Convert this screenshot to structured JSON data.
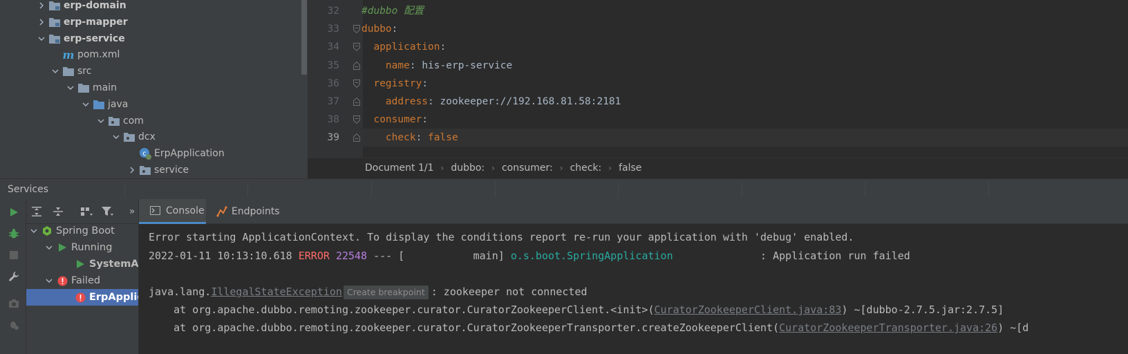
{
  "project_tree": {
    "items": [
      {
        "label": "erp-domain",
        "bold": true,
        "indent": 0,
        "chevron": ">",
        "icon": "module-folder-icon"
      },
      {
        "label": "erp-mapper",
        "bold": true,
        "indent": 0,
        "chevron": ">",
        "icon": "module-folder-icon"
      },
      {
        "label": "erp-service",
        "bold": true,
        "indent": 0,
        "chevron": "v",
        "icon": "module-folder-icon"
      },
      {
        "label": "pom.xml",
        "bold": false,
        "indent": 1,
        "chevron": "",
        "icon": "maven-icon"
      },
      {
        "label": "src",
        "bold": false,
        "indent": 1,
        "chevron": "v",
        "icon": "folder-icon"
      },
      {
        "label": "main",
        "bold": false,
        "indent": 2,
        "chevron": "v",
        "icon": "folder-icon"
      },
      {
        "label": "java",
        "bold": false,
        "indent": 3,
        "chevron": "v",
        "icon": "source-folder-icon"
      },
      {
        "label": "com",
        "bold": false,
        "indent": 4,
        "chevron": "v",
        "icon": "package-icon"
      },
      {
        "label": "dcx",
        "bold": false,
        "indent": 5,
        "chevron": "v",
        "icon": "package-icon"
      },
      {
        "label": "ErpApplication",
        "bold": false,
        "indent": 6,
        "chevron": "",
        "icon": "spring-class-icon"
      },
      {
        "label": "service",
        "bold": false,
        "indent": 6,
        "chevron": ">",
        "icon": "package-icon"
      }
    ]
  },
  "editor": {
    "lines": [
      {
        "num": "32",
        "comment": "#dubbo 配置"
      },
      {
        "num": "33",
        "key": "dubbo",
        "value": ""
      },
      {
        "num": "34",
        "key": "application",
        "value": ""
      },
      {
        "num": "35",
        "key": "name",
        "value": "his-erp-service"
      },
      {
        "num": "36",
        "key": "registry",
        "value": ""
      },
      {
        "num": "37",
        "key": "address",
        "value": "zookeeper://192.168.81.58:2181"
      },
      {
        "num": "38",
        "key": "consumer",
        "value": ""
      },
      {
        "num": "39",
        "key": "check",
        "value": "false"
      }
    ],
    "breadcrumb": [
      "Document 1/1",
      "dubbo:",
      "consumer:",
      "check:",
      "false"
    ]
  },
  "services": {
    "title": "Services",
    "tree": [
      {
        "label": "Spring Boot",
        "chevron": "v",
        "icon": "spring-boot-icon",
        "indent": 0
      },
      {
        "label": "Running",
        "chevron": "v",
        "icon": "run-icon",
        "indent": 1
      },
      {
        "label": "SystemAp",
        "chevron": "",
        "icon": "run-icon",
        "indent": 2,
        "bold": true
      },
      {
        "label": "Failed",
        "chevron": "v",
        "icon": "error-icon",
        "indent": 1
      },
      {
        "label": "ErpApplica",
        "chevron": "",
        "icon": "error-icon",
        "indent": 2,
        "bold": true,
        "selected": true
      }
    ],
    "tabs": [
      {
        "label": "Console",
        "icon": "console-icon",
        "active": true
      },
      {
        "label": "Endpoints",
        "icon": "endpoints-icon",
        "active": false
      }
    ]
  },
  "console": {
    "line1": "Error starting ApplicationContext. To display the conditions report re-run your application with 'debug' enabled.",
    "line2": {
      "timestamp": "2022-01-11 10:13:10.618",
      "level": "ERROR",
      "pid": "22548",
      "sep": "--- [",
      "thread": "           main]",
      "logger": "o.s.boot.SpringApplication",
      "message": "              : Application run failed"
    },
    "line4": {
      "prefix": "java.lang.",
      "exception": "IllegalStateException",
      "hint": "Create breakpoint",
      "message": ": zookeeper not connected"
    },
    "line5": {
      "prefix": "    at org.apache.dubbo.remoting.zookeeper.curator.CuratorZookeeperClient.<init>(",
      "link": "CuratorZookeeperClient.java:83",
      "suffix": ") ~[dubbo-2.7.5.jar:2.7.5]"
    },
    "line6": {
      "prefix": "    at org.apache.dubbo.remoting.zookeeper.curator.CuratorZookeeperTransporter.createZookeeperClient(",
      "link": "CuratorZookeeperTransporter.java:26",
      "suffix": ") ~[d"
    }
  },
  "colors": {
    "key": "#cc7832",
    "value": "#a9b7c6",
    "comment": "#629755",
    "error": "#ff6b68",
    "logger": "#2aaaa0",
    "pid": "#b87fe0",
    "selection": "#4b6eaf"
  }
}
